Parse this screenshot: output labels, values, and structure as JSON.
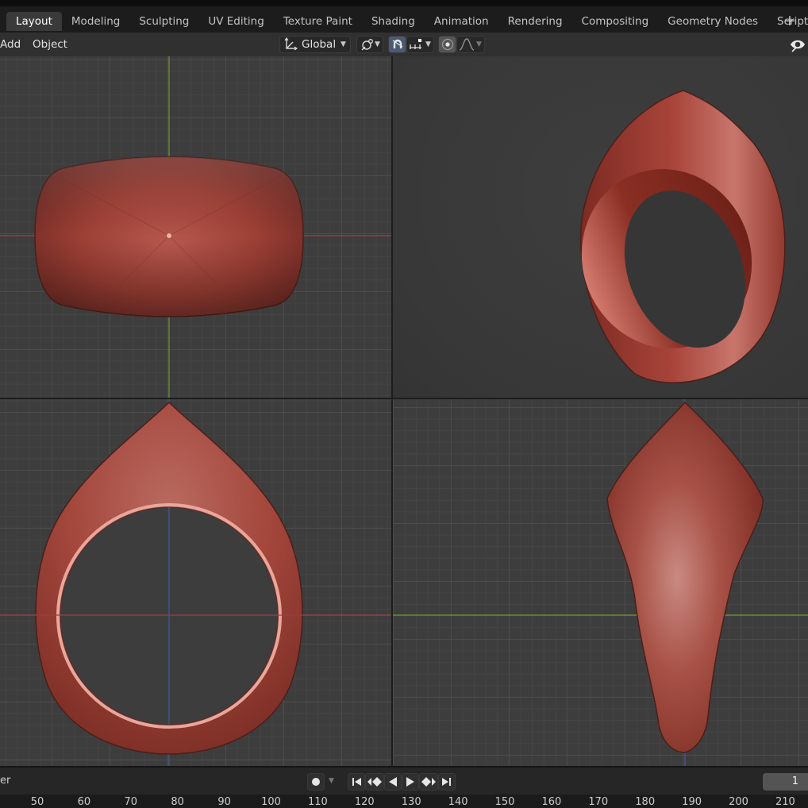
{
  "workspace_tabs": [
    "Layout",
    "Modeling",
    "Sculpting",
    "UV Editing",
    "Texture Paint",
    "Shading",
    "Animation",
    "Rendering",
    "Compositing",
    "Geometry Nodes",
    "Scripting"
  ],
  "active_tab": "Layout",
  "add_tab_label": "+",
  "header": {
    "menu_add": "Add",
    "menu_object": "Object",
    "orientation": "Global"
  },
  "icons": {
    "orientation": "transform-orientation-icon",
    "pivot": "pivot-point-icon",
    "snap": "snap-magnet-icon",
    "snap_target": "snap-increment-icon",
    "proportional": "proportional-editing-icon",
    "falloff": "falloff-curve-icon",
    "visibility": "eye-visibility-icon"
  },
  "colors": {
    "ring": "#a8443a",
    "x_axis": "#9b3f47",
    "y_axis": "#6f9a2f",
    "z_axis": "#3e5c9e",
    "active_tab_bg": "#3a3a3a"
  },
  "timeline": {
    "label": "er",
    "current_frame": "1",
    "ticks": [
      "50",
      "60",
      "70",
      "80",
      "90",
      "100",
      "110",
      "120",
      "130",
      "140",
      "150",
      "160",
      "170",
      "180",
      "190",
      "200",
      "210"
    ]
  }
}
